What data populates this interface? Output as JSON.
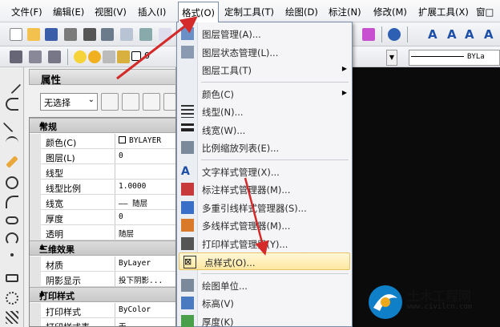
{
  "menubar": {
    "items": [
      "文件(F)",
      "编辑(E)",
      "视图(V)",
      "插入(I)",
      "格式(O)",
      "定制工具(T)",
      "绘图(D)",
      "标注(N)",
      "修改(M)",
      "扩展工具(X)",
      "窗□"
    ],
    "active_index": 4
  },
  "toolbar": {
    "color_text": "0",
    "linetype_text": "BYLa"
  },
  "panel": {
    "title": "属性",
    "select_value": "无选择",
    "sections": [
      {
        "title": "常规",
        "rows": [
          [
            "颜色(C)",
            "BYLAYER"
          ],
          [
            "图层(L)",
            "0"
          ],
          [
            "线型",
            ""
          ],
          [
            "线型比例",
            "1.0000"
          ],
          [
            "线宽",
            "—— 随层"
          ],
          [
            "厚度",
            "0"
          ],
          [
            "透明",
            "随层"
          ]
        ]
      },
      {
        "title": "三维效果",
        "rows": [
          [
            "材质",
            "ByLayer"
          ],
          [
            "阴影显示",
            "投下阴影..."
          ]
        ]
      },
      {
        "title": "打印样式",
        "rows": [
          [
            "打印样式",
            "ByColor"
          ],
          [
            "打印样式表",
            "无"
          ]
        ]
      }
    ]
  },
  "format_menu": {
    "items": [
      {
        "label": "图层管理(A)...",
        "icon": "layer-manager-icon",
        "sub": false
      },
      {
        "label": "图层状态管理(L)...",
        "icon": "layer-state-icon",
        "sub": false
      },
      {
        "label": "图层工具(T)",
        "icon": "",
        "sub": true
      },
      {
        "sep": true
      },
      {
        "label": "颜色(C)",
        "icon": "",
        "sub": true
      },
      {
        "label": "线型(N)...",
        "icon": "linetype-icon",
        "sub": false
      },
      {
        "label": "线宽(W)...",
        "icon": "lineweight-icon",
        "sub": false
      },
      {
        "label": "比例缩放列表(E)...",
        "icon": "scale-list-icon",
        "sub": false
      },
      {
        "sep": true
      },
      {
        "label": "文字样式管理(X)...",
        "icon": "text-style-icon",
        "sub": false
      },
      {
        "label": "标注样式管理器(M)...",
        "icon": "dim-style-icon",
        "sub": false
      },
      {
        "label": "多重引线样式管理器(S)...",
        "icon": "mleader-style-icon",
        "sub": false
      },
      {
        "label": "多线样式管理器(M)...",
        "icon": "mline-style-icon",
        "sub": false
      },
      {
        "label": "打印样式管理器(Y)...",
        "icon": "plot-style-icon",
        "sub": false
      },
      {
        "label": "点样式(O)...",
        "icon": "point-style-icon",
        "sub": false,
        "highlight": true
      },
      {
        "sep": true
      },
      {
        "label": "绘图单位...",
        "icon": "units-icon",
        "sub": false
      },
      {
        "label": "标高(V)",
        "icon": "elevation-icon",
        "sub": false
      },
      {
        "label": "厚度(K)",
        "icon": "thickness-icon",
        "sub": false
      }
    ]
  },
  "watermark": {
    "title": "土木工程网",
    "url": "www.civilcn.com"
  },
  "colors": {
    "arrow": "#d42a2a",
    "highlight": "#fde7a0",
    "canvas_dark": "#0b0b0b"
  }
}
